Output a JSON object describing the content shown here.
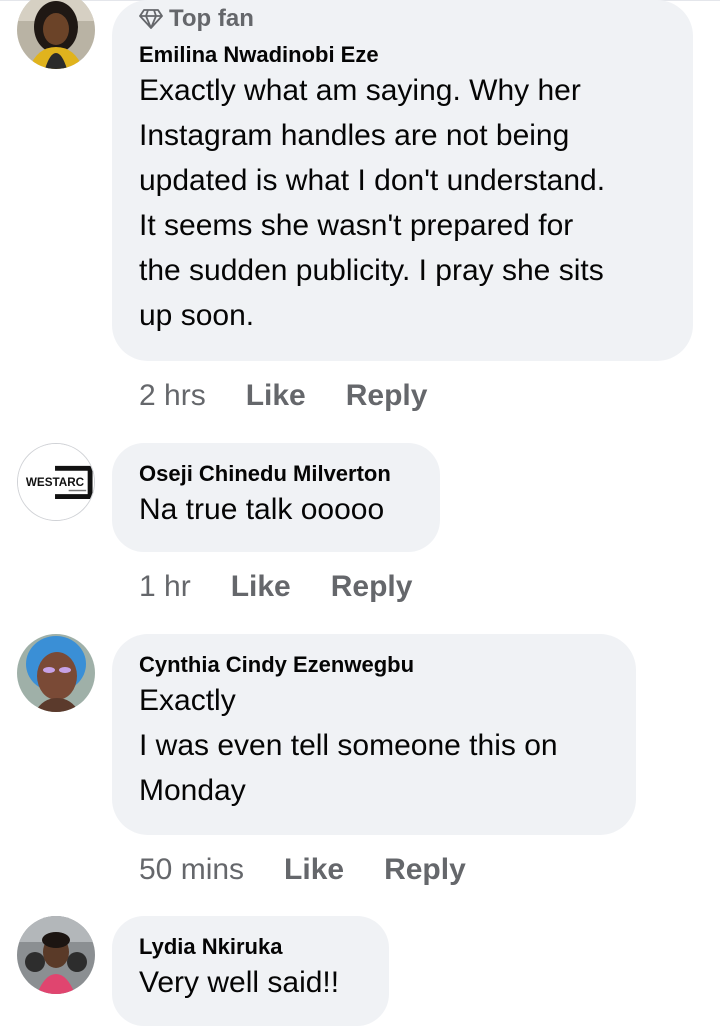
{
  "comments": [
    {
      "badge": "Top fan",
      "author": "Emilina Nwadinobi Eze",
      "text": "Exactly what am saying. Why her\nInstagram handles are not being\nupdated is what I don't understand.\nIt seems she wasn't prepared for\nthe sudden publicity. I pray she sits\nup soon.",
      "time": "2 hrs",
      "like_label": "Like",
      "reply_label": "Reply"
    },
    {
      "author": "Oseji Chinedu Milverton",
      "avatar_logo": "WESTARC",
      "text": "Na true talk ooooo",
      "time": "1 hr",
      "like_label": "Like",
      "reply_label": "Reply"
    },
    {
      "author": "Cynthia Cindy Ezenwegbu",
      "text": "Exactly\nI was even tell someone this on\nMonday",
      "time": "50 mins",
      "like_label": "Like",
      "reply_label": "Reply"
    },
    {
      "author": "Lydia Nkiruka",
      "text": "Very well said!!"
    }
  ],
  "colors": {
    "bubble": "#f0f2f5",
    "secondary_text": "#65676b",
    "primary_text": "#050505"
  }
}
